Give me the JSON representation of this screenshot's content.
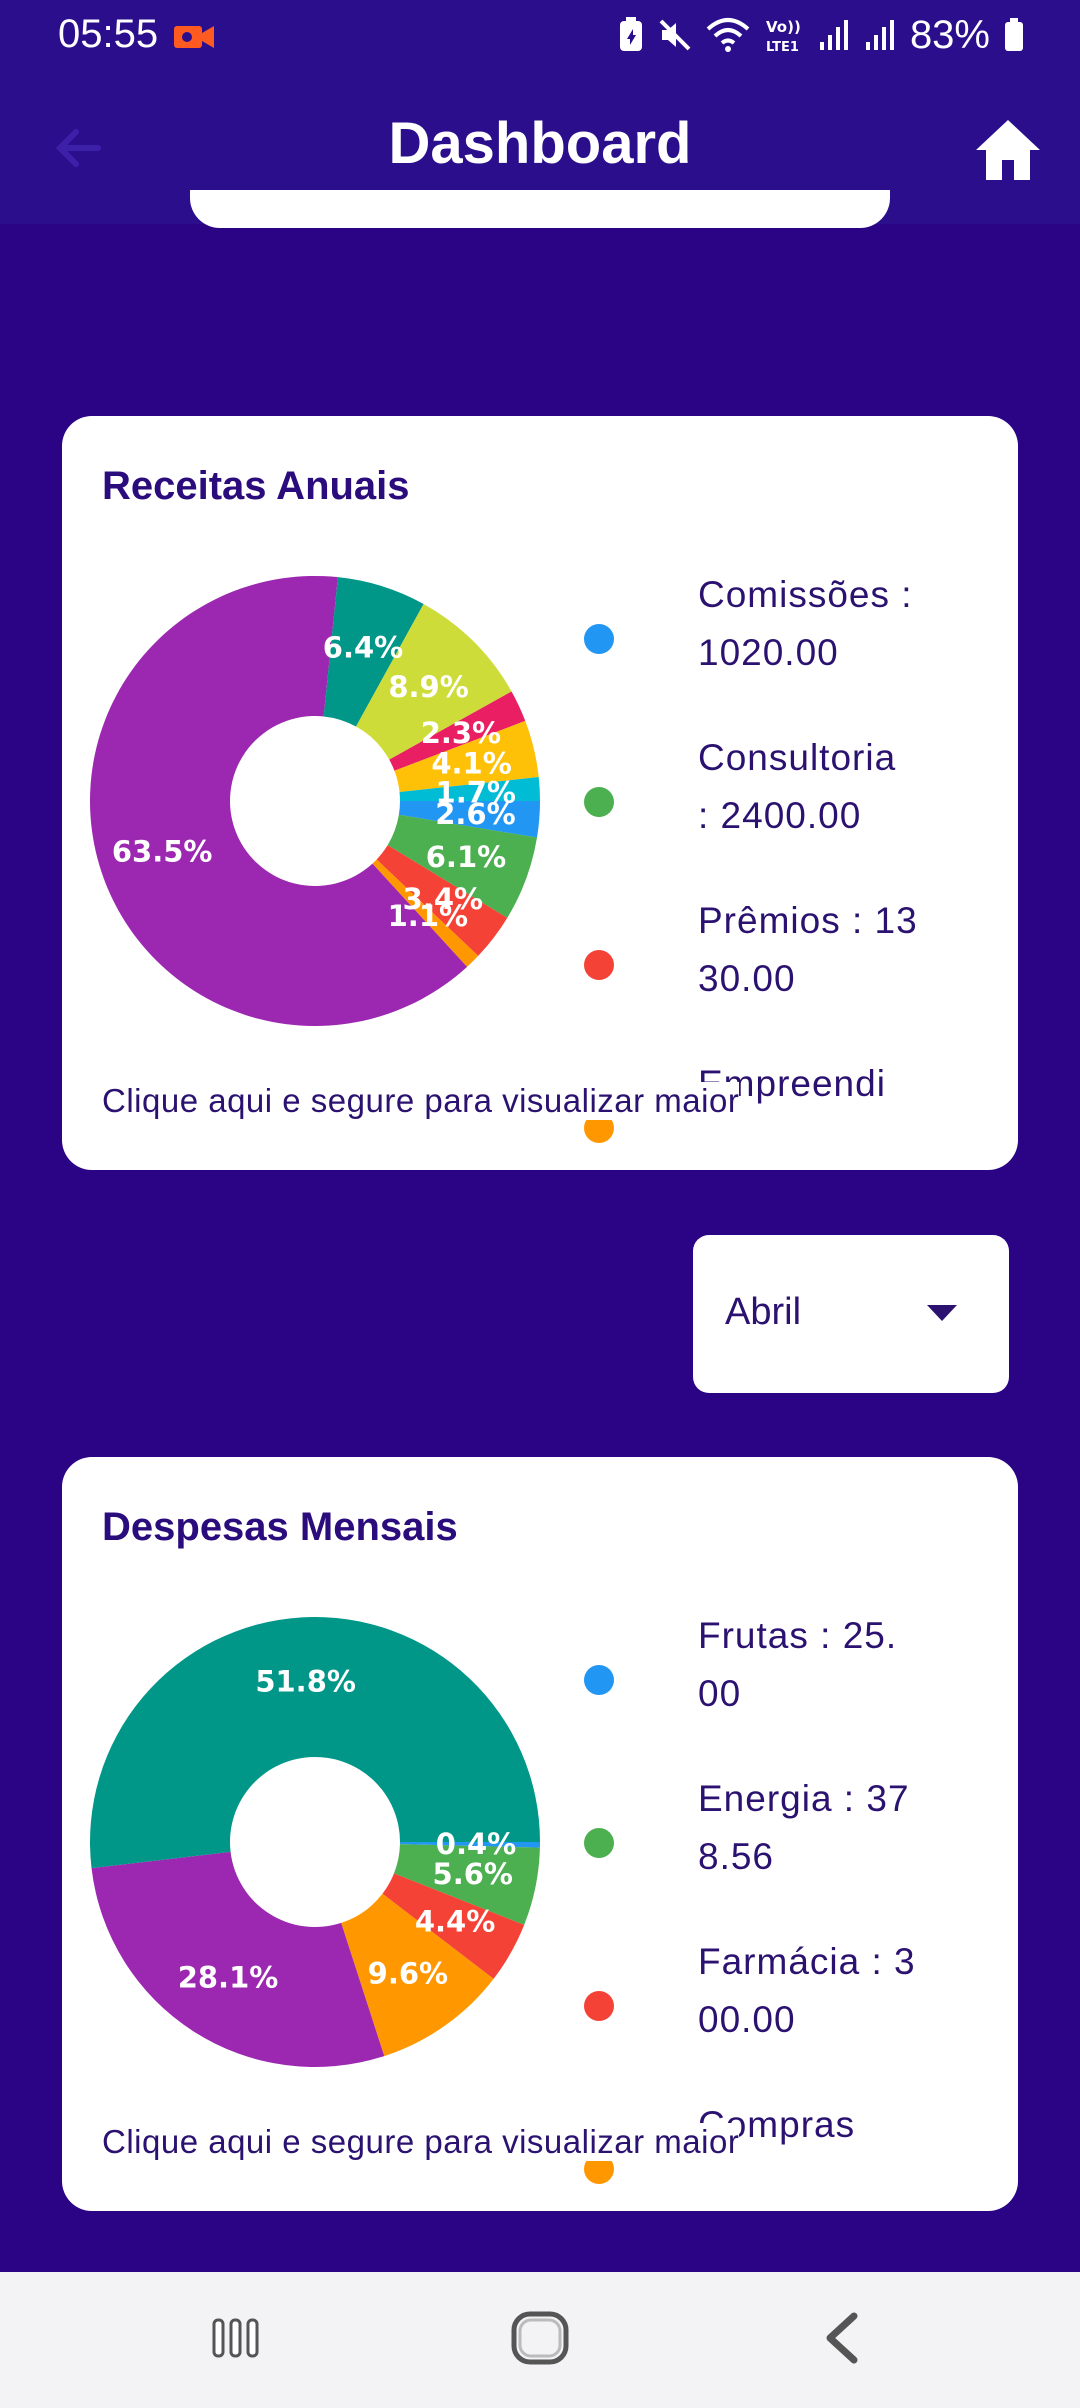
{
  "status_bar": {
    "time": "05:55",
    "battery_text": "83%",
    "icons": [
      "video-recording-icon",
      "battery-saver-icon",
      "mute-icon",
      "wifi-icon",
      "volte-icon",
      "signal-icon",
      "signal-icon",
      "battery-icon"
    ]
  },
  "app_bar": {
    "title": "Dashboard",
    "back_icon": "arrow-back-icon",
    "home_icon": "home-icon"
  },
  "colors": {
    "background": "#2b0486",
    "app_bar": "#2a0e8c",
    "card": "#ffffff",
    "text": "#2b1270"
  },
  "receitas_card": {
    "title": "Receitas Anuais",
    "hint": "Clique aqui e segure para visualizar maior",
    "legend": [
      {
        "label": "Comissões : 1020.00",
        "color": "#2196f3"
      },
      {
        "label": "Consultoria : 2400.00",
        "color": "#4caf50"
      },
      {
        "label": "Prêmios : 1330.00",
        "color": "#f44336"
      },
      {
        "label": "Empreendi",
        "color": "#ff9800"
      }
    ],
    "chart_data": {
      "type": "pie",
      "slices": [
        {
          "value": 2.6,
          "label": "2.6%",
          "color": "#2196f3"
        },
        {
          "value": 6.1,
          "label": "6.1%",
          "color": "#4caf50"
        },
        {
          "value": 3.4,
          "label": "3.4%",
          "color": "#f44336"
        },
        {
          "value": 1.1,
          "label": "1.1%",
          "color": "#ff9800"
        },
        {
          "value": 63.5,
          "label": "63.5%",
          "color": "#9c27b0"
        },
        {
          "value": 6.4,
          "label": "6.4%",
          "color": "#009688"
        },
        {
          "value": 8.9,
          "label": "8.9%",
          "color": "#cddc39"
        },
        {
          "value": 2.3,
          "label": "2.3%",
          "color": "#e91e63"
        },
        {
          "value": 4.1,
          "label": "4.1%",
          "color": "#ffc107"
        },
        {
          "value": 1.7,
          "label": "1.7%",
          "color": "#00bcd4"
        }
      ]
    }
  },
  "month_dropdown": {
    "selected": "Abril",
    "arrow_icon": "dropdown-arrow-icon"
  },
  "despesas_card": {
    "title": "Despesas Mensais",
    "hint": "Clique aqui e segure para visualizar maior",
    "legend": [
      {
        "label": "Frutas : 25.00",
        "color": "#2196f3"
      },
      {
        "label": "Energia : 378.56",
        "color": "#4caf50"
      },
      {
        "label": "Farmácia : 300.00",
        "color": "#f44336"
      },
      {
        "label": "Compras",
        "color": "#ff9800"
      }
    ],
    "chart_data": {
      "type": "pie",
      "slices": [
        {
          "value": 0.4,
          "label": "0.4%",
          "color": "#2196f3"
        },
        {
          "value": 5.6,
          "label": "5.6%",
          "color": "#4caf50"
        },
        {
          "value": 4.4,
          "label": "4.4%",
          "color": "#f44336"
        },
        {
          "value": 9.6,
          "label": "9.6%",
          "color": "#ff9800"
        },
        {
          "value": 28.1,
          "label": "28.1%",
          "color": "#9c27b0"
        },
        {
          "value": 51.8,
          "label": "51.8%",
          "color": "#009688"
        }
      ]
    }
  },
  "nav_bar": {
    "recents_icon": "recent-apps-icon",
    "home_icon": "home-circle-icon",
    "back_icon": "back-chevron-icon"
  }
}
